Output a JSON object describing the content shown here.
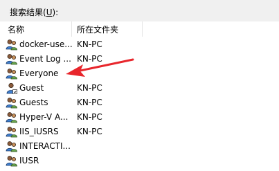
{
  "results": {
    "label_prefix": "搜索结果(",
    "label_mnemonic": "U",
    "label_suffix": "):"
  },
  "columns": {
    "name": "名称",
    "folder": "所在文件夹"
  },
  "rows": [
    {
      "name": "docker-use...",
      "folder": "KN-PC",
      "icon": "user-group-icon"
    },
    {
      "name": "Event Log ...",
      "folder": "KN-PC",
      "icon": "user-group-icon"
    },
    {
      "name": "Everyone",
      "folder": "",
      "icon": "user-group-icon"
    },
    {
      "name": "Guest",
      "folder": "KN-PC",
      "icon": "user-icon"
    },
    {
      "name": "Guests",
      "folder": "KN-PC",
      "icon": "user-group-icon"
    },
    {
      "name": "Hyper-V A...",
      "folder": "KN-PC",
      "icon": "user-group-icon"
    },
    {
      "name": "IIS_IUSRS",
      "folder": "KN-PC",
      "icon": "user-group-icon"
    },
    {
      "name": "INTERACTI...",
      "folder": "",
      "icon": "user-group-icon"
    },
    {
      "name": "IUSR",
      "folder": "",
      "icon": "user-group-icon"
    }
  ],
  "annotation": {
    "arrow_color": "#e8262c"
  }
}
